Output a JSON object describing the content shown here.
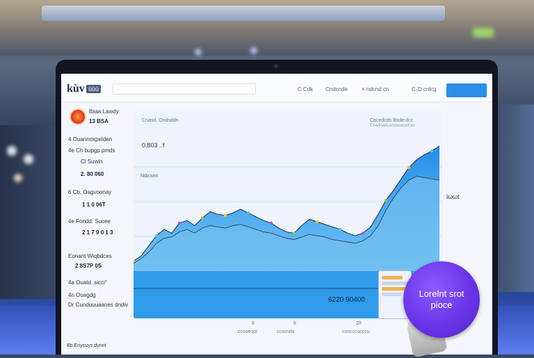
{
  "header": {
    "logo": "kùv",
    "logo_badge": "ǔǔǔ",
    "search_placeholder": "",
    "nav": [
      "C Cdk",
      "Cndcnde",
      "× ndcnd cn",
      "C₂D cnlcg"
    ],
    "cta_label": ""
  },
  "sidebar": {
    "title": "Ibiaa Lawdy",
    "subtitle": "13 BSA",
    "items": [
      {
        "label": "4 Ouannoxpelden",
        "value": "",
        "label2": "4e Ch bupgp pmds"
      },
      {
        "label": "Cl Suwin",
        "value": "2. 80 060"
      },
      {
        "label": "6 Cb, Oagvoonay",
        "value": "1 1 0 06T"
      },
      {
        "label": "4e Fondd. Sucee",
        "value": "2 1 7 9 0 1 3"
      },
      {
        "label": "Eonant Wiqbdces",
        "value": "2 8S7P 0S"
      },
      {
        "label": "4a Ouatd .sicci°",
        "value": ""
      },
      {
        "label": "4n Ouagdg",
        "value": ""
      },
      {
        "label": "Dr Cunduuuaanes dndiv",
        "value": ""
      }
    ]
  },
  "chart_card": {
    "title": "Cnasd. Ondsddn",
    "legend": "Cacedcds Bsde-dcc",
    "legend_sub": "Cnadnadcacnacacud ds",
    "y_label_top": "0.803 . f",
    "y_label_mid": "Ndicsnn",
    "price": "6220 90400",
    "right_label": "lωωt"
  },
  "chart_data": {
    "type": "area",
    "x": [
      0,
      1,
      2,
      3,
      4,
      5,
      6,
      7,
      8,
      9,
      10,
      11,
      12,
      13,
      14,
      15,
      16,
      17,
      18,
      19,
      20,
      21,
      22,
      23,
      24,
      25,
      26,
      27,
      28,
      29,
      30,
      31,
      32,
      33,
      34,
      35,
      36,
      37,
      38,
      39,
      40
    ],
    "series": [
      {
        "values": [
          8,
          12,
          20,
          28,
          33,
          30,
          38,
          40,
          36,
          42,
          47,
          45,
          44,
          46,
          49,
          46,
          43,
          40,
          38,
          34,
          31,
          30,
          36,
          41,
          39,
          37,
          35,
          33,
          30,
          28,
          30,
          35,
          45,
          56,
          64,
          73,
          82,
          88,
          92,
          95,
          99
        ]
      },
      {
        "values": [
          6,
          10,
          15,
          22,
          26,
          27,
          31,
          33,
          30,
          34,
          36,
          35,
          34,
          36,
          37,
          35,
          33,
          31,
          30,
          28,
          26,
          25,
          27,
          29,
          28,
          27,
          25,
          24,
          23,
          22,
          24,
          28,
          36,
          48,
          58,
          66,
          72,
          75,
          74,
          73,
          72
        ]
      }
    ],
    "ylim": [
      0,
      110
    ],
    "annotations": [
      "6220 90400",
      "lωωt"
    ]
  },
  "footer": {
    "ticks": [
      "II",
      "II",
      "2/I"
    ],
    "labels": [
      "ccsoeuor",
      "ccscnds",
      "coscccucccu"
    ],
    "bottom": "Bb Enyouys,dynnt"
  },
  "promo": {
    "line1": "Lorelnt srot",
    "line2": "pioce"
  },
  "colors": {
    "accent": "#2d8ee6",
    "promo": "#6a34e8",
    "area": "#2b9ae8"
  }
}
